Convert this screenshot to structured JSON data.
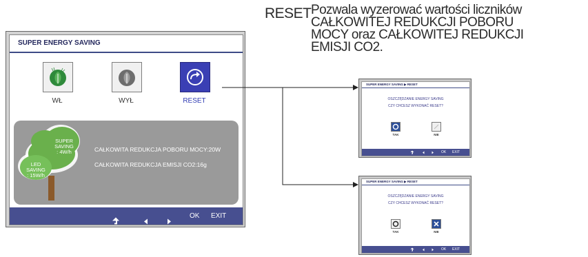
{
  "caption": {
    "reset_word": "RESET",
    "description_lines": [
      "Pozwala wyzerować wartości liczników",
      "CAŁKOWITEJ REDUKCJI POBORU",
      "MOCY oraz CAŁKOWITEJ REDUKCJI",
      "EMISJI CO2."
    ]
  },
  "osd": {
    "title": "SUPER ENERGY SAVING",
    "options": [
      {
        "label": "WŁ",
        "icon": "leaf-on-icon",
        "selected": false
      },
      {
        "label": "WYŁ",
        "icon": "leaf-off-icon",
        "selected": false
      },
      {
        "label": "RESET",
        "icon": "reset-arrow-icon",
        "selected": true
      }
    ],
    "tree": {
      "super_label": "SUPER\nSAVING",
      "super_value": ": 4W/h",
      "led_label": "LED\nSAVING",
      "led_value": ": 15W/h"
    },
    "info": {
      "power_reduction": "CAŁKOWITA REDUKCJA POBORU MOCY:20W",
      "co2_reduction": "CAŁKOWITA REDUKCJA EMISJI CO2:16g"
    },
    "nav": {
      "ok": "OK",
      "exit": "EXIT"
    },
    "colors": {
      "navbar": "#474f90",
      "selected_icon": "#3a3fb4",
      "leaf_green": "#2f8a3b",
      "tree_green": "#6ab04c"
    }
  },
  "dialogs": [
    {
      "title": "SUPER ENERGY SAVING ▶ RESET",
      "line1": "OSZCZĘDZANIE ENERGY SAVING",
      "line2": "CZY CHCESZ WYKONAĆ RESET?",
      "yes_label": "TAK",
      "no_label": "NIE",
      "selected": "yes",
      "nav": {
        "ok": "OK",
        "exit": "EXIT"
      }
    },
    {
      "title": "SUPER ENERGY SAVING ▶ RESET",
      "line1": "OSZCZĘDZANIE ENERGY SAVING",
      "line2": "CZY CHCESZ WYKONAĆ RESET?",
      "yes_label": "TAK",
      "no_label": "NIE",
      "selected": "no",
      "nav": {
        "ok": "OK",
        "exit": "EXIT"
      }
    }
  ]
}
